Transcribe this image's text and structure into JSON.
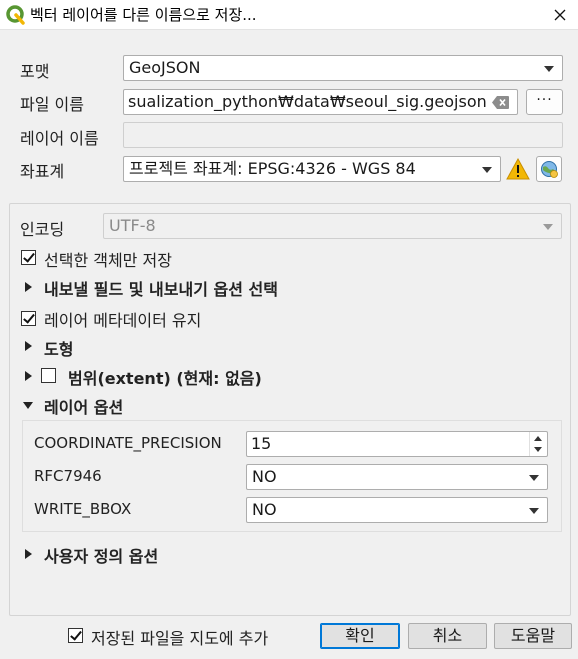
{
  "window": {
    "title": "벡터 레이어를 다른 이름으로 저장...",
    "icon": "qgis-logo-icon",
    "close_icon": "close-icon"
  },
  "form": {
    "format_label": "포맷",
    "format_value": "GeoJSON",
    "filename_label": "파일 이름",
    "filename_value": "sualization_python₩data₩seoul_sig.geojson",
    "browse_label": "···",
    "layername_label": "레이어 이름",
    "layername_value": "",
    "crs_label": "좌표계",
    "crs_value": "프로젝트 좌표계: EPSG:4326 - WGS 84"
  },
  "options": {
    "encoding_label": "인코딩",
    "encoding_value": "UTF-8",
    "selected_only_label": "선택한 객체만 저장",
    "selected_only_checked": true,
    "export_fields_label": "내보낼 필드 및 내보내기 옵션 선택",
    "persist_metadata_label": "레이어 메타데이터 유지",
    "persist_metadata_checked": true,
    "geometry_label": "도형",
    "extent_label": "범위(extent) (현재: 없음)",
    "extent_checked": false,
    "layer_options_label": "레이어 옵션",
    "layer_options": [
      {
        "name": "COORDINATE_PRECISION",
        "value": "15"
      },
      {
        "name": "RFC7946",
        "value": "NO"
      },
      {
        "name": "WRITE_BBOX",
        "value": "NO"
      }
    ],
    "custom_options_label": "사용자 정의 옵션"
  },
  "footer": {
    "add_to_map_label": "저장된 파일을 지도에 추가",
    "add_to_map_checked": true,
    "ok_label": "확인",
    "cancel_label": "취소",
    "help_label": "도움말"
  },
  "colors": {
    "accent": "#0078d7",
    "warning": "#f2b705",
    "qgis_green": "#589632"
  }
}
